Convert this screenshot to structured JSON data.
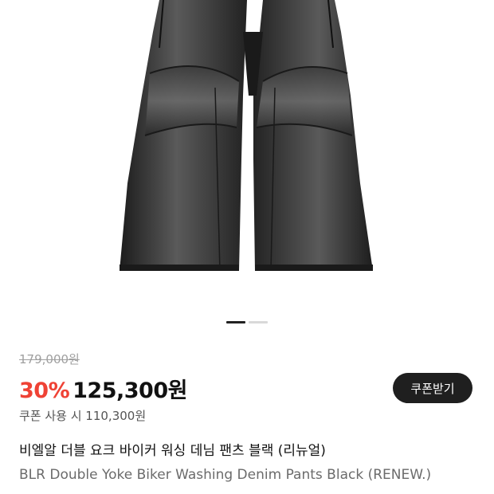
{
  "product": {
    "image_alt": "black washed denim biker pants",
    "original_price": "179,000원",
    "discount": "30%",
    "sale_price": "125,300원",
    "coupon_button": "쿠폰받기",
    "coupon_price_text": "쿠폰 사용 시 110,300원",
    "name_ko": "비엘알 더블 요크 바이커 워싱 데님 팬츠 블랙 (리뉴얼)",
    "name_en": "BLR Double Yoke Biker Washing Denim Pants Black (RENEW.)"
  },
  "carousel": {
    "total": 2,
    "active_index": 1
  },
  "colors": {
    "discount": "#ef4235",
    "coupon_button_bg": "#1f1f1f",
    "denim": "#2a2a2a"
  }
}
